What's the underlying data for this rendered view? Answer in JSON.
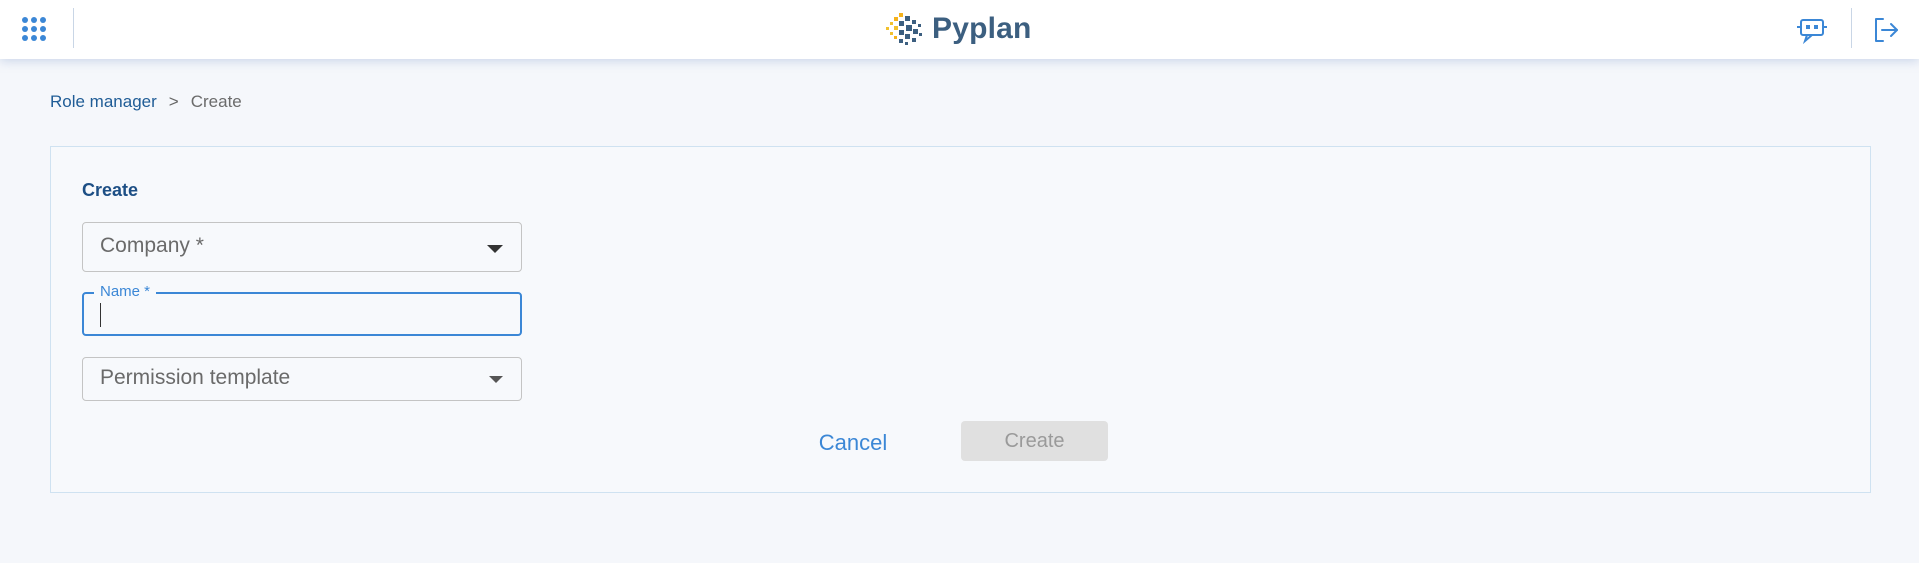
{
  "header": {
    "app_name": "Pyplan",
    "apps_menu_icon": "apps-grid-icon",
    "chat_icon": "chat-bubble-icon",
    "logout_icon": "logout-icon",
    "accent_color": "#3b87d6",
    "brand_color": "#3c5f80"
  },
  "breadcrumb": {
    "parent": "Role manager",
    "separator": ">",
    "current": "Create"
  },
  "form": {
    "title": "Create",
    "company_label": "Company *",
    "name_label": "Name *",
    "name_value": "",
    "permission_label": "Permission template",
    "cancel_label": "Cancel",
    "create_label": "Create"
  }
}
